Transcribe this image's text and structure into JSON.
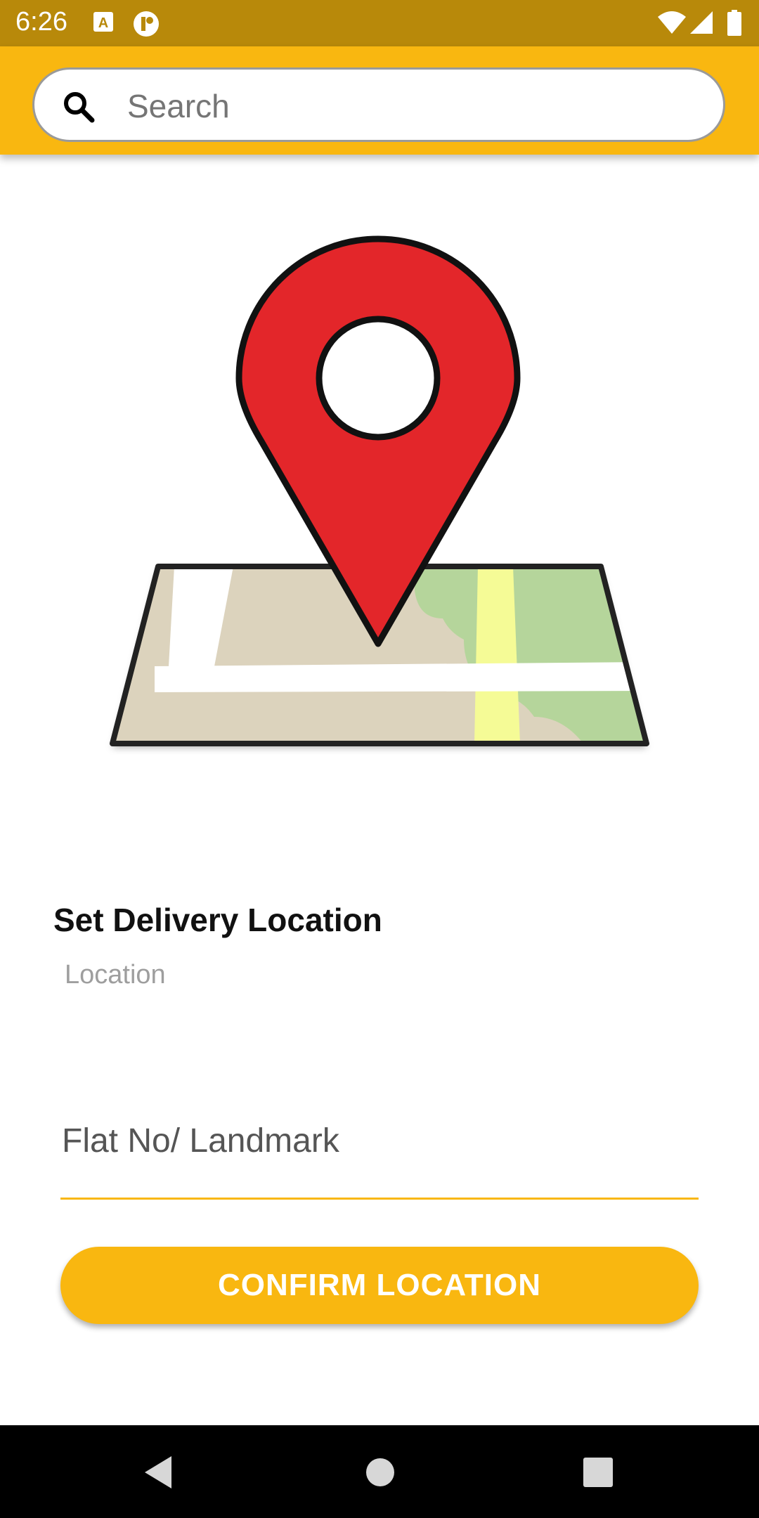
{
  "status_bar": {
    "time": "6:26",
    "icons": [
      "a-keyboard-icon",
      "notification-app-icon",
      "wifi-icon",
      "signal-icon",
      "battery-icon"
    ]
  },
  "header": {
    "search": {
      "placeholder": "Search",
      "value": ""
    }
  },
  "illustration": {
    "name": "map-location-pin-illustration"
  },
  "form": {
    "title": "Set Delivery Location",
    "location_text": "Location",
    "landmark": {
      "placeholder": "Flat No/ Landmark",
      "value": ""
    },
    "confirm_label": "CONFIRM LOCATION"
  },
  "nav": {
    "buttons": [
      "back-icon",
      "home-icon",
      "recents-icon"
    ]
  },
  "colors": {
    "accent": "#f9b710",
    "status_bar": "#b8890a",
    "pin": "#e3262a"
  }
}
